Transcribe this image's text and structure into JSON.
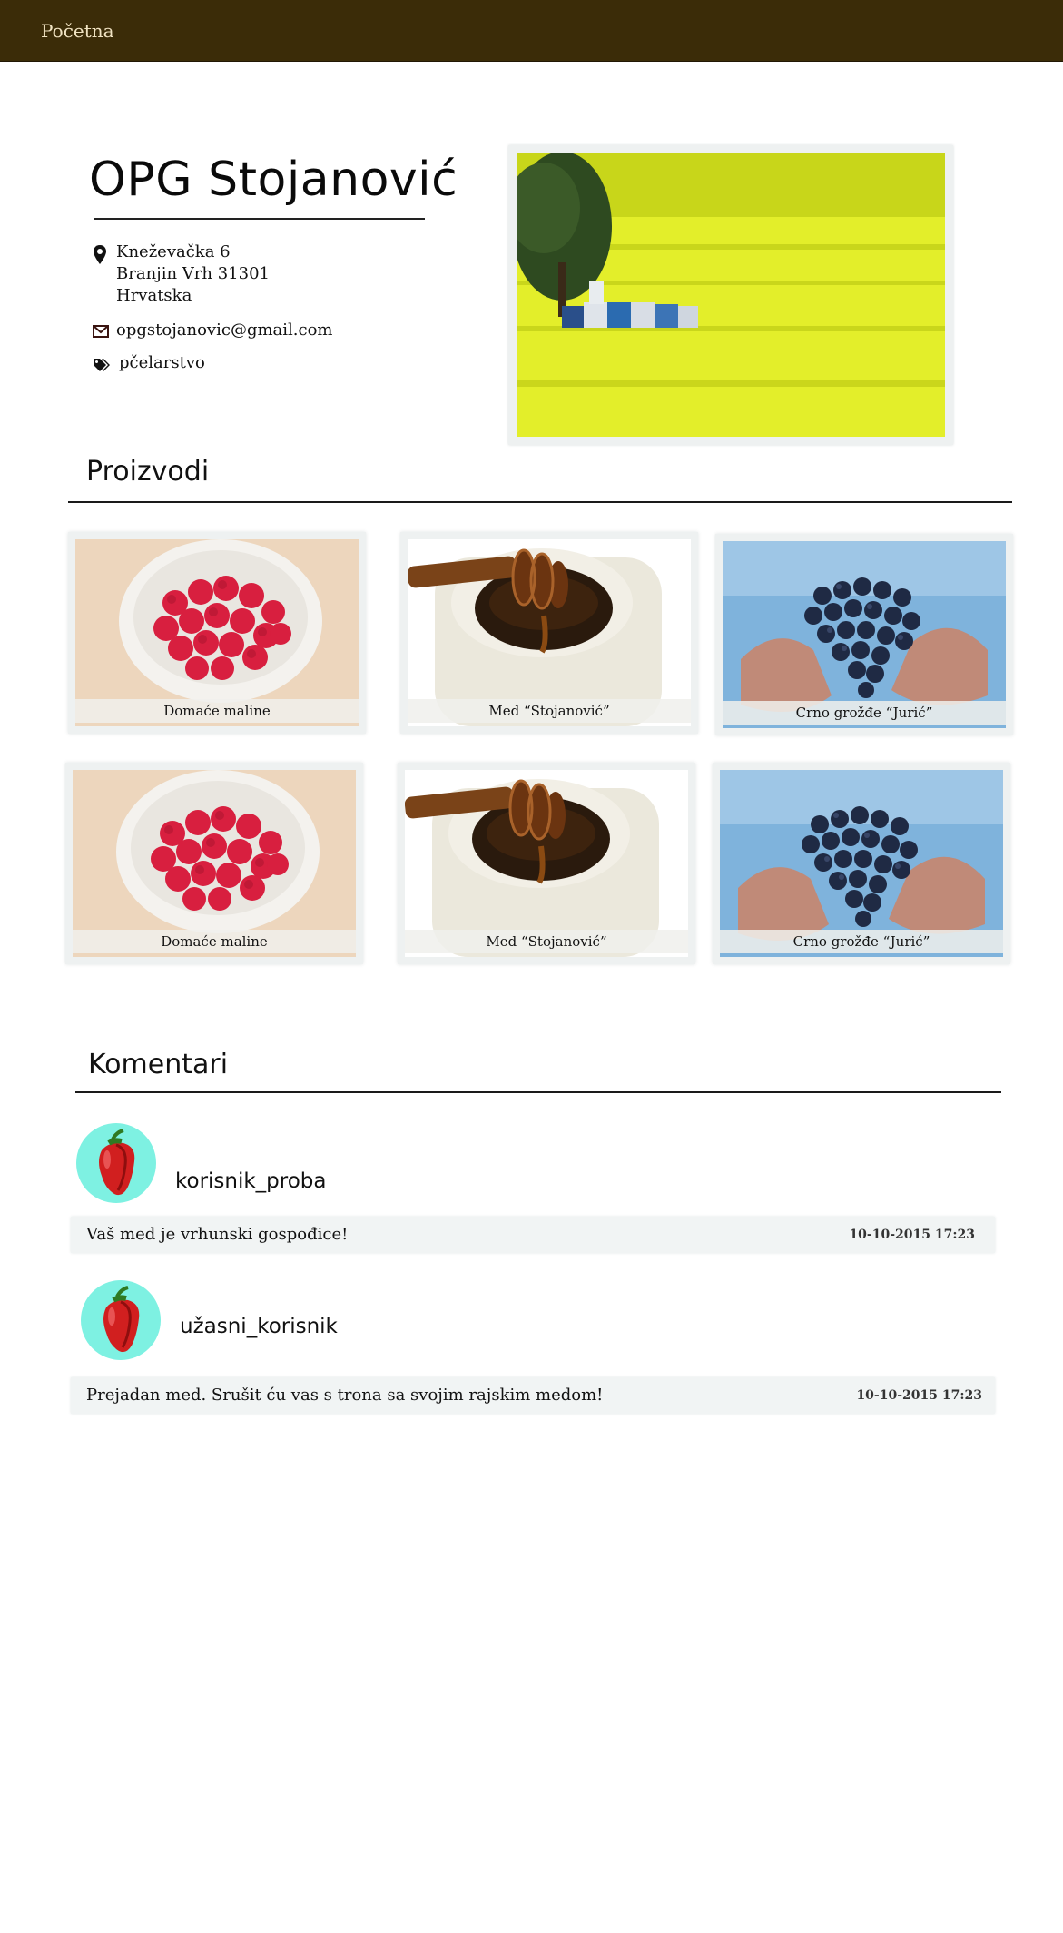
{
  "nav": {
    "home_label": "Početna"
  },
  "farm": {
    "title": "OPG Stojanović",
    "address": [
      "Kneževačka 6",
      "Branjin Vrh 31301",
      "Hrvatska"
    ],
    "email": "opgstojanovic@gmail.com",
    "tag": "pčelarstvo"
  },
  "products": {
    "heading": "Proizvodi",
    "items": [
      {
        "label": "Domaće maline",
        "image": "raspberries"
      },
      {
        "label": "Med “Stojanović”",
        "image": "honey"
      },
      {
        "label": "Crno grožđe “Jurić”",
        "image": "grapes"
      },
      {
        "label": "Domaće maline",
        "image": "raspberries"
      },
      {
        "label": "Med “Stojanović”",
        "image": "honey"
      },
      {
        "label": "Crno grožđe “Jurić”",
        "image": "grapes"
      }
    ]
  },
  "comments": {
    "heading": "Komentari",
    "items": [
      {
        "user": "korisnik_proba",
        "text": "Vaš med je vrhunski gospođice!",
        "time": "10-10-2015  17:23",
        "avatar": "pepper-icon"
      },
      {
        "user": "užasni_korisnik",
        "text": "Prejadan med. Srušit ću vas s trona sa svojim rajskim medom!",
        "time": "10-10-2015  17:23",
        "avatar": "pepper-icon"
      }
    ]
  },
  "colors": {
    "nav_bg": "#3b2c08",
    "nav_text": "#f0e3c2",
    "avatar_bg": "#7ef1e2"
  }
}
